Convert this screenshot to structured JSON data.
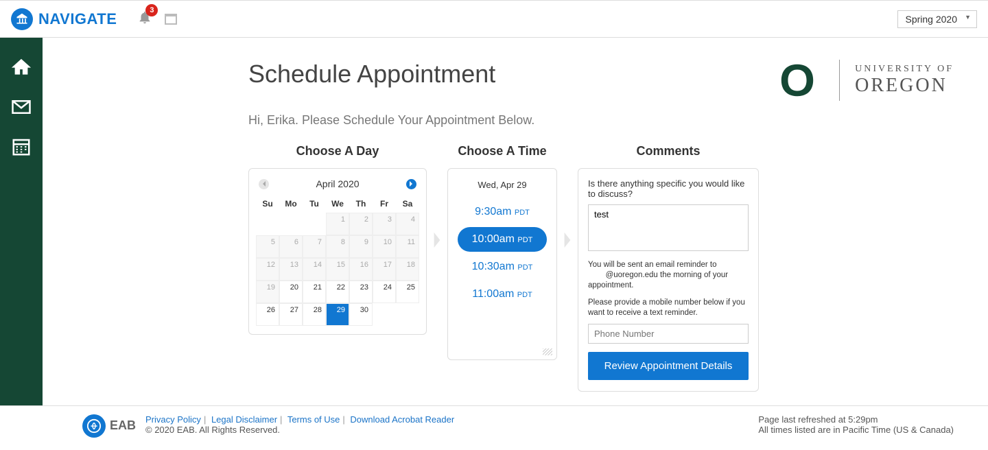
{
  "header": {
    "brand": "NAVIGATE",
    "notification_count": "3",
    "term_selected": "Spring 2020"
  },
  "university": {
    "top": "UNIVERSITY OF",
    "bottom": "OREGON"
  },
  "page": {
    "title": "Schedule Appointment",
    "subheading": "Hi, Erika. Please Schedule Your Appointment Below."
  },
  "choose_day": {
    "title": "Choose A Day",
    "month_label": "April 2020",
    "dow": [
      "Su",
      "Mo",
      "Tu",
      "We",
      "Th",
      "Fr",
      "Sa"
    ],
    "weeks": [
      [
        {
          "n": "",
          "s": "blank"
        },
        {
          "n": "",
          "s": "blank"
        },
        {
          "n": "",
          "s": "blank"
        },
        {
          "n": "1",
          "s": "dim"
        },
        {
          "n": "2",
          "s": "dim"
        },
        {
          "n": "3",
          "s": "dim"
        },
        {
          "n": "4",
          "s": "dim"
        }
      ],
      [
        {
          "n": "5",
          "s": "dim"
        },
        {
          "n": "6",
          "s": "dim"
        },
        {
          "n": "7",
          "s": "dim"
        },
        {
          "n": "8",
          "s": "dim"
        },
        {
          "n": "9",
          "s": "dim"
        },
        {
          "n": "10",
          "s": "dim"
        },
        {
          "n": "11",
          "s": "dim"
        }
      ],
      [
        {
          "n": "12",
          "s": "dim"
        },
        {
          "n": "13",
          "s": "dim"
        },
        {
          "n": "14",
          "s": "dim"
        },
        {
          "n": "15",
          "s": "dim"
        },
        {
          "n": "16",
          "s": "dim"
        },
        {
          "n": "17",
          "s": "dim"
        },
        {
          "n": "18",
          "s": "dim"
        }
      ],
      [
        {
          "n": "19",
          "s": "dim"
        },
        {
          "n": "20",
          "s": "avail"
        },
        {
          "n": "21",
          "s": "avail"
        },
        {
          "n": "22",
          "s": "avail"
        },
        {
          "n": "23",
          "s": "avail"
        },
        {
          "n": "24",
          "s": "avail"
        },
        {
          "n": "25",
          "s": "avail"
        }
      ],
      [
        {
          "n": "26",
          "s": "avail"
        },
        {
          "n": "27",
          "s": "avail"
        },
        {
          "n": "28",
          "s": "avail"
        },
        {
          "n": "29",
          "s": "selected"
        },
        {
          "n": "30",
          "s": "avail"
        },
        {
          "n": "",
          "s": "blank"
        },
        {
          "n": "",
          "s": "blank"
        }
      ]
    ]
  },
  "choose_time": {
    "title": "Choose A Time",
    "date_label": "Wed, Apr 29",
    "slots": [
      {
        "time": "9:30am",
        "tz": "PDT",
        "selected": false
      },
      {
        "time": "10:00am",
        "tz": "PDT",
        "selected": true
      },
      {
        "time": "10:30am",
        "tz": "PDT",
        "selected": false
      },
      {
        "time": "11:00am",
        "tz": "PDT",
        "selected": false
      }
    ]
  },
  "comments": {
    "title": "Comments",
    "prompt": "Is there anything specific you would like to discuss?",
    "value": "test",
    "reminder_line1": "You will be sent an email reminder to",
    "reminder_line2": "@uoregon.edu the morning of your appointment.",
    "mobile_prompt": "Please provide a mobile number below if you want to receive a text reminder.",
    "phone_placeholder": "Phone Number",
    "button_label": "Review Appointment Details"
  },
  "footer": {
    "eab": "EAB",
    "links": {
      "privacy": "Privacy Policy",
      "legal": "Legal Disclaimer",
      "terms": "Terms of Use",
      "acrobat": "Download Acrobat Reader"
    },
    "copyright": "© 2020 EAB. All Rights Reserved.",
    "refreshed": "Page last refreshed at 5:29pm",
    "timezone": "All times listed are in Pacific Time (US & Canada)"
  }
}
